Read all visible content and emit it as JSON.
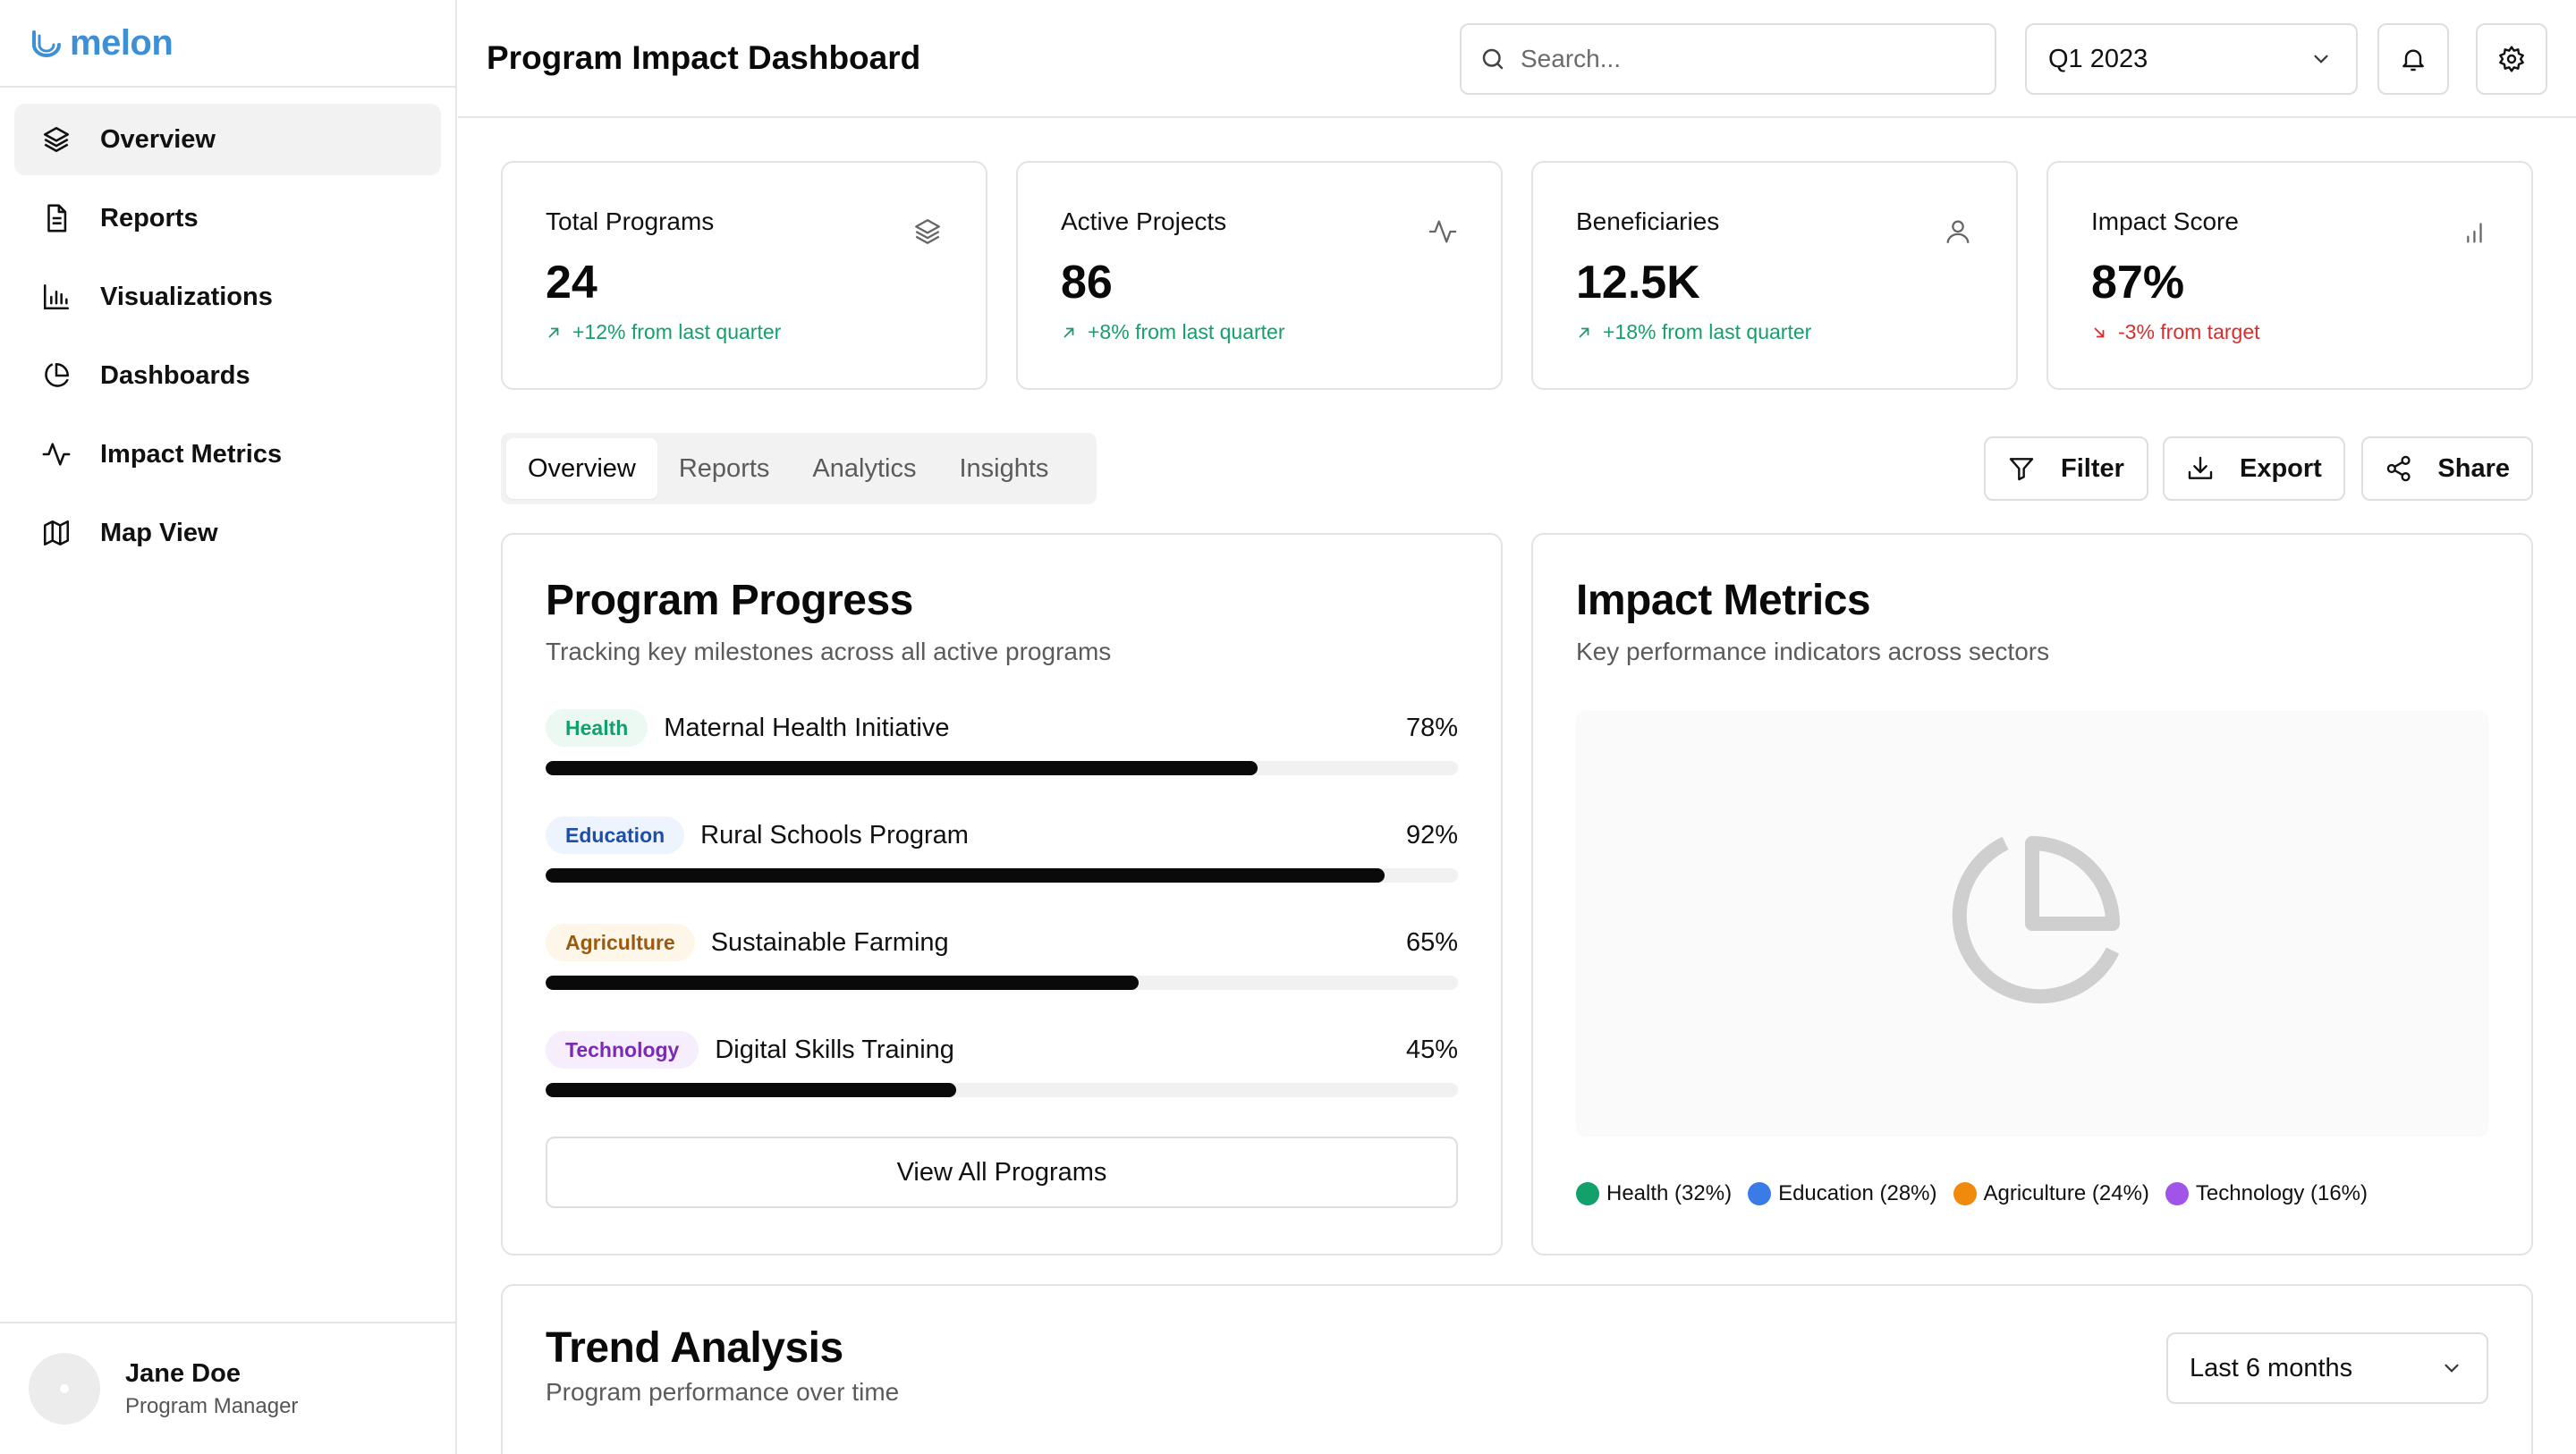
{
  "brand": {
    "name": "melon",
    "color": "#3d8fd6"
  },
  "sidebar": {
    "items": [
      {
        "label": "Overview",
        "icon": "layers-icon",
        "active": true
      },
      {
        "label": "Reports",
        "icon": "file-text-icon",
        "active": false
      },
      {
        "label": "Visualizations",
        "icon": "bar-chart-icon",
        "active": false
      },
      {
        "label": "Dashboards",
        "icon": "pie-chart-icon",
        "active": false
      },
      {
        "label": "Impact Metrics",
        "icon": "activity-icon",
        "active": false
      },
      {
        "label": "Map View",
        "icon": "map-icon",
        "active": false
      }
    ]
  },
  "user": {
    "name": "Jane Doe",
    "role": "Program Manager"
  },
  "header": {
    "title": "Program Impact Dashboard",
    "search_placeholder": "Search...",
    "period": "Q1 2023"
  },
  "stats": [
    {
      "label": "Total Programs",
      "value": "24",
      "change": "+12% from last quarter",
      "trend": "up",
      "icon": "layers-icon"
    },
    {
      "label": "Active Projects",
      "value": "86",
      "change": "+8% from last quarter",
      "trend": "up",
      "icon": "activity-icon"
    },
    {
      "label": "Beneficiaries",
      "value": "12.5K",
      "change": "+18% from last quarter",
      "trend": "up",
      "icon": "user-icon"
    },
    {
      "label": "Impact Score",
      "value": "87%",
      "change": "-3% from target",
      "trend": "down",
      "icon": "bar-chart-icon"
    }
  ],
  "tabs": [
    {
      "label": "Overview",
      "active": true
    },
    {
      "label": "Reports",
      "active": false
    },
    {
      "label": "Analytics",
      "active": false
    },
    {
      "label": "Insights",
      "active": false
    }
  ],
  "actions": {
    "filter": "Filter",
    "export": "Export",
    "share": "Share"
  },
  "program_progress": {
    "title": "Program Progress",
    "subtitle": "Tracking key milestones across all active programs",
    "items": [
      {
        "tag": "Health",
        "name": "Maternal Health Initiative",
        "percent_label": "78%",
        "progress": 0.78,
        "tag_color": "#14a06a",
        "tag_bg": "#ecf8f2"
      },
      {
        "tag": "Education",
        "name": "Rural Schools Program",
        "percent_label": "92%",
        "progress": 0.92,
        "tag_color": "#1e4fa8",
        "tag_bg": "#eef4fd"
      },
      {
        "tag": "Agriculture",
        "name": "Sustainable Farming",
        "percent_label": "65%",
        "progress": 0.65,
        "tag_color": "#9a5a10",
        "tag_bg": "#fdf6e9"
      },
      {
        "tag": "Technology",
        "name": "Digital Skills Training",
        "percent_label": "45%",
        "progress": 0.45,
        "tag_color": "#7a2bb5",
        "tag_bg": "#f6eefc"
      }
    ],
    "view_all_label": "View All Programs"
  },
  "impact_metrics": {
    "title": "Impact Metrics",
    "subtitle": "Key performance indicators across sectors",
    "placeholder_icon": "pie-chart-icon",
    "legend": [
      {
        "label": "Health (32%)",
        "color": "#14a06a"
      },
      {
        "label": "Education (28%)",
        "color": "#3b7be8"
      },
      {
        "label": "Agriculture (24%)",
        "color": "#f08a0c"
      },
      {
        "label": "Technology (16%)",
        "color": "#a055e8"
      }
    ]
  },
  "trend": {
    "title": "Trend Analysis",
    "subtitle": "Program performance over time",
    "range": "Last 6 months"
  }
}
